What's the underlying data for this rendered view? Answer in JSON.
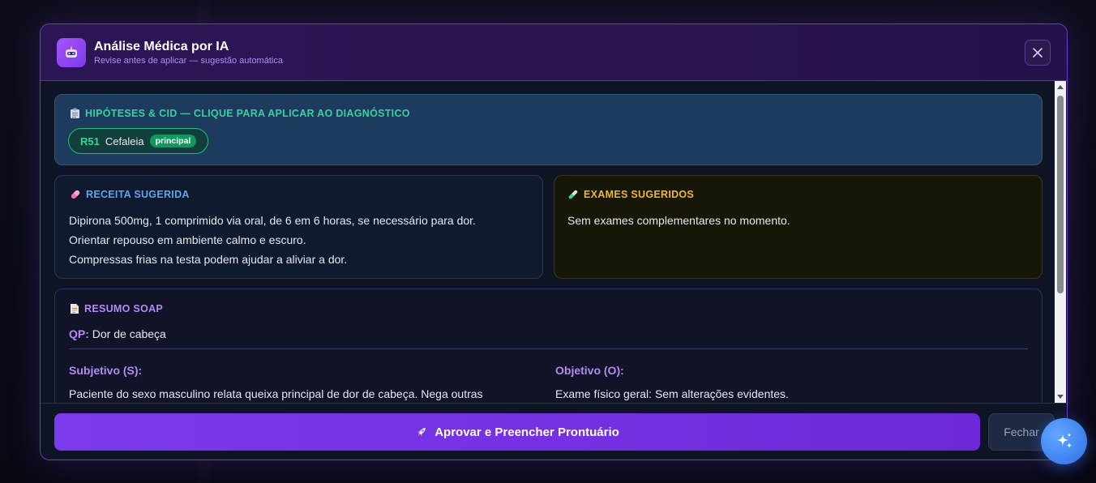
{
  "header": {
    "title": "Análise Médica por IA",
    "subtitle": "Revise antes de aplicar — sugestão automática",
    "icon": "robot-icon"
  },
  "cid": {
    "title": "HIPÓTESES & CID — CLIQUE PARA APLICAR AO DIAGNÓSTICO",
    "items": [
      {
        "code": "R51",
        "name": "Cefaleia",
        "badge": "principal"
      }
    ],
    "accent": "#37d39a"
  },
  "prescription": {
    "title": "RECEITA SUGERIDA",
    "lines": [
      "Dipirona 500mg, 1 comprimido via oral, de 6 em 6 horas, se necessário para dor.",
      "Orientar repouso em ambiente calmo e escuro.",
      "Compressas frias na testa podem ajudar a aliviar a dor."
    ],
    "accent": "#5aa6f5"
  },
  "exams": {
    "title": "EXAMES SUGERIDOS",
    "text": "Sem exames complementares no momento.",
    "accent": "#f3b626"
  },
  "soap": {
    "title": "RESUMO SOAP",
    "qp_label": "QP:",
    "qp_value": "Dor de cabeça",
    "subjective": {
      "title": "Subjetivo (S):",
      "text": "Paciente do sexo masculino relata queixa principal de dor de cabeça. Nega outras"
    },
    "objective": {
      "title": "Objetivo (O):",
      "text": "Exame físico geral: Sem alterações evidentes."
    },
    "accent": "#b48af5"
  },
  "footer": {
    "approve_label": "Aprovar e Preencher Prontuário",
    "close_label": "Fechar"
  },
  "colors": {
    "primary": "#7c3aed",
    "fab": "#2f6fe6"
  }
}
